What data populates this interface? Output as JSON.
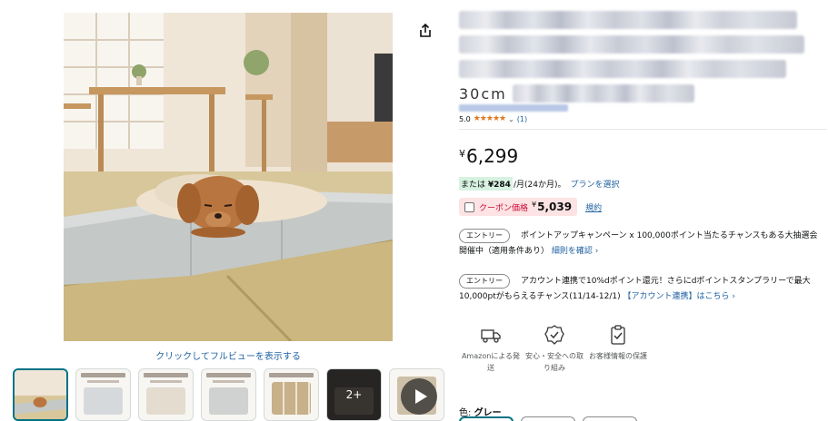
{
  "gallery": {
    "fullview_link": "クリックしてフルビューを表示する",
    "thumbnails": [
      {
        "name": "main"
      },
      {
        "name": "img-2"
      },
      {
        "name": "img-3"
      },
      {
        "name": "img-4"
      },
      {
        "name": "img-5"
      },
      {
        "name": "img-6",
        "more_label": "2+"
      },
      {
        "name": "video"
      }
    ]
  },
  "product": {
    "title_visible_fragment": "30cm",
    "rating": "5.0",
    "stars_glyph": "★★★★★",
    "review_count": "(1)"
  },
  "price": {
    "currency": "¥",
    "amount": "6,299"
  },
  "installment": {
    "prefix": "または",
    "monthly": "¥284",
    "suffix": "/月(24か月)。",
    "plan_link": "プランを選択"
  },
  "coupon": {
    "label": "クーポン価格",
    "currency": "¥",
    "amount": "5,039",
    "terms_link": "規約"
  },
  "promos": [
    {
      "entry_label": "エントリー",
      "text": "ポイントアップキャンペーン x 100,000ポイント当たるチャンスもある大抽選会 開催中（適用条件あり）",
      "link": "細則を確認"
    },
    {
      "entry_label": "エントリー",
      "text": "アカウント連携で10%dポイント還元！さらにdポイントスタンプラリーで最大10,000ptがもらえるチャンス(11/14-12/1)",
      "link": "【アカウント連携】はこちら"
    }
  ],
  "features": [
    {
      "icon": "truck-icon",
      "label": "Amazonによる発送"
    },
    {
      "icon": "badge-check-icon",
      "label": "安心・安全への取り組み"
    },
    {
      "icon": "clipboard-check-icon",
      "label": "お客様情報の保護"
    }
  ],
  "variation": {
    "label": "色:",
    "value": "グレー"
  },
  "colors": {
    "link": "#2162a1",
    "price_text": "#0f1111",
    "coupon_bg": "#fde3e3",
    "coupon_label": "#cc0c39",
    "installment_bg": "#d7f2e0",
    "star": "#de7921",
    "selected_border": "#007185"
  }
}
